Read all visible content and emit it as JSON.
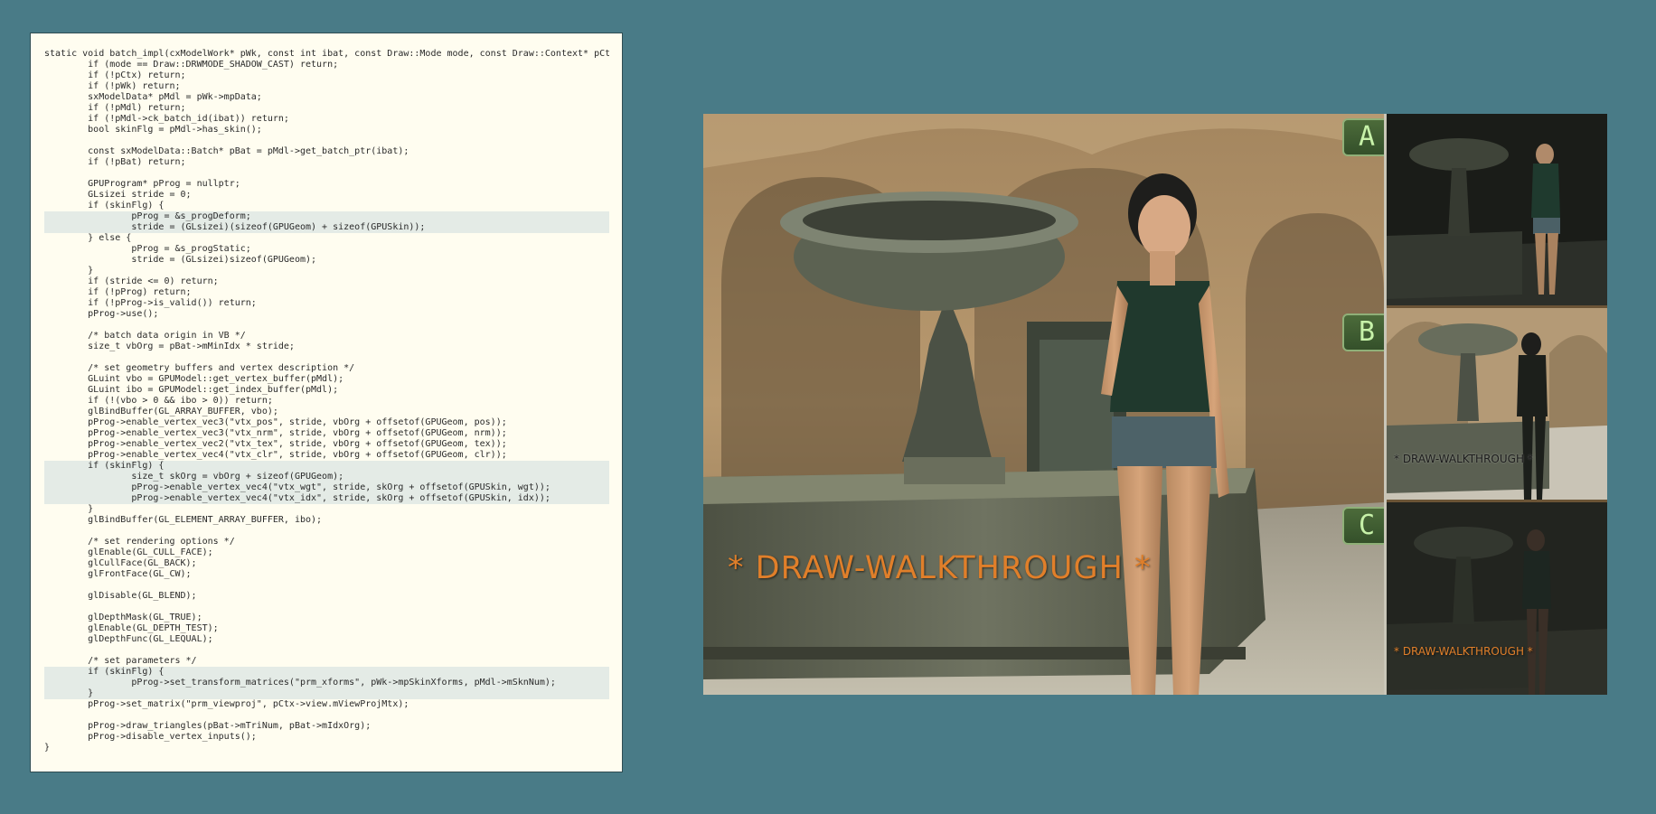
{
  "code": {
    "lines": [
      {
        "text": "static void batch_impl(cxModelWork* pWk, const int ibat, const Draw::Mode mode, const Draw::Context* pCtx) {",
        "hl": false
      },
      {
        "text": "        if (mode == Draw::DRWMODE_SHADOW_CAST) return;",
        "hl": false
      },
      {
        "text": "        if (!pCtx) return;",
        "hl": false
      },
      {
        "text": "        if (!pWk) return;",
        "hl": false
      },
      {
        "text": "        sxModelData* pMdl = pWk->mpData;",
        "hl": false
      },
      {
        "text": "        if (!pMdl) return;",
        "hl": false
      },
      {
        "text": "        if (!pMdl->ck_batch_id(ibat)) return;",
        "hl": false
      },
      {
        "text": "        bool skinFlg = pMdl->has_skin();",
        "hl": false
      },
      {
        "text": "",
        "hl": false
      },
      {
        "text": "        const sxModelData::Batch* pBat = pMdl->get_batch_ptr(ibat);",
        "hl": false
      },
      {
        "text": "        if (!pBat) return;",
        "hl": false
      },
      {
        "text": "",
        "hl": false
      },
      {
        "text": "        GPUProgram* pProg = nullptr;",
        "hl": false
      },
      {
        "text": "        GLsizei stride = 0;",
        "hl": false
      },
      {
        "text": "        if (skinFlg) {",
        "hl": false
      },
      {
        "text": "                pProg = &s_progDeform;",
        "hl": true
      },
      {
        "text": "                stride = (GLsizei)(sizeof(GPUGeom) + sizeof(GPUSkin));",
        "hl": true
      },
      {
        "text": "        } else {",
        "hl": false
      },
      {
        "text": "                pProg = &s_progStatic;",
        "hl": false
      },
      {
        "text": "                stride = (GLsizei)sizeof(GPUGeom);",
        "hl": false
      },
      {
        "text": "        }",
        "hl": false
      },
      {
        "text": "        if (stride <= 0) return;",
        "hl": false
      },
      {
        "text": "        if (!pProg) return;",
        "hl": false
      },
      {
        "text": "        if (!pProg->is_valid()) return;",
        "hl": false
      },
      {
        "text": "        pProg->use();",
        "hl": false
      },
      {
        "text": "",
        "hl": false
      },
      {
        "text": "        /* batch data origin in VB */",
        "hl": false
      },
      {
        "text": "        size_t vbOrg = pBat->mMinIdx * stride;",
        "hl": false
      },
      {
        "text": "",
        "hl": false
      },
      {
        "text": "        /* set geometry buffers and vertex description */",
        "hl": false
      },
      {
        "text": "        GLuint vbo = GPUModel::get_vertex_buffer(pMdl);",
        "hl": false
      },
      {
        "text": "        GLuint ibo = GPUModel::get_index_buffer(pMdl);",
        "hl": false
      },
      {
        "text": "        if (!(vbo > 0 && ibo > 0)) return;",
        "hl": false
      },
      {
        "text": "        glBindBuffer(GL_ARRAY_BUFFER, vbo);",
        "hl": false
      },
      {
        "text": "        pProg->enable_vertex_vec3(\"vtx_pos\", stride, vbOrg + offsetof(GPUGeom, pos));",
        "hl": false
      },
      {
        "text": "        pProg->enable_vertex_vec3(\"vtx_nrm\", stride, vbOrg + offsetof(GPUGeom, nrm));",
        "hl": false
      },
      {
        "text": "        pProg->enable_vertex_vec2(\"vtx_tex\", stride, vbOrg + offsetof(GPUGeom, tex));",
        "hl": false
      },
      {
        "text": "        pProg->enable_vertex_vec4(\"vtx_clr\", stride, vbOrg + offsetof(GPUGeom, clr));",
        "hl": false
      },
      {
        "text": "        if (skinFlg) {",
        "hl": true
      },
      {
        "text": "                size_t skOrg = vbOrg + sizeof(GPUGeom);",
        "hl": true
      },
      {
        "text": "                pProg->enable_vertex_vec4(\"vtx_wgt\", stride, skOrg + offsetof(GPUSkin, wgt));",
        "hl": true
      },
      {
        "text": "                pProg->enable_vertex_vec4(\"vtx_idx\", stride, skOrg + offsetof(GPUSkin, idx));",
        "hl": true
      },
      {
        "text": "        }",
        "hl": false
      },
      {
        "text": "        glBindBuffer(GL_ELEMENT_ARRAY_BUFFER, ibo);",
        "hl": false
      },
      {
        "text": "",
        "hl": false
      },
      {
        "text": "        /* set rendering options */",
        "hl": false
      },
      {
        "text": "        glEnable(GL_CULL_FACE);",
        "hl": false
      },
      {
        "text": "        glCullFace(GL_BACK);",
        "hl": false
      },
      {
        "text": "        glFrontFace(GL_CW);",
        "hl": false
      },
      {
        "text": "",
        "hl": false
      },
      {
        "text": "        glDisable(GL_BLEND);",
        "hl": false
      },
      {
        "text": "",
        "hl": false
      },
      {
        "text": "        glDepthMask(GL_TRUE);",
        "hl": false
      },
      {
        "text": "        glEnable(GL_DEPTH_TEST);",
        "hl": false
      },
      {
        "text": "        glDepthFunc(GL_LEQUAL);",
        "hl": false
      },
      {
        "text": "",
        "hl": false
      },
      {
        "text": "        /* set parameters */",
        "hl": false
      },
      {
        "text": "        if (skinFlg) {",
        "hl": true
      },
      {
        "text": "                pProg->set_transform_matrices(\"prm_xforms\", pWk->mpSkinXforms, pMdl->mSknNum);",
        "hl": true
      },
      {
        "text": "        }",
        "hl": true
      },
      {
        "text": "        pProg->set_matrix(\"prm_viewproj\", pCtx->view.mViewProjMtx);",
        "hl": false
      },
      {
        "text": "",
        "hl": false
      },
      {
        "text": "        pProg->draw_triangles(pBat->mTriNum, pBat->mIdxOrg);",
        "hl": false
      },
      {
        "text": "        pProg->disable_vertex_inputs();",
        "hl": false
      },
      {
        "text": "}",
        "hl": false
      }
    ]
  },
  "scene": {
    "watermark": "* DRAW-WALKTHROUGH *",
    "badges": {
      "a": "A",
      "b": "B",
      "c": "C"
    }
  },
  "colors": {
    "background": "#497b87",
    "code_background": "#fffdf0",
    "highlight": "#e4ebe6",
    "watermark": "#e07f2a",
    "badge": "#4c6b3a"
  }
}
